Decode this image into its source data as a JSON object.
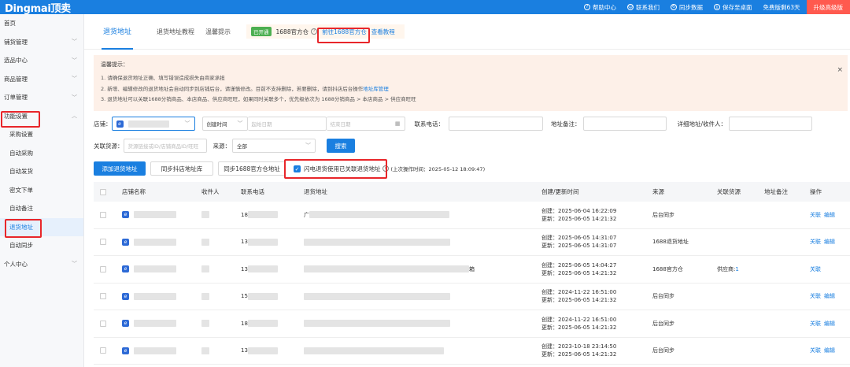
{
  "topbar": {
    "logo": "Dingmai顶卖",
    "links": [
      {
        "icon": "help-circle-icon",
        "glyph": "?",
        "label": "帮助中心"
      },
      {
        "icon": "contact-icon",
        "glyph": "☺",
        "label": "联系我们"
      },
      {
        "icon": "sync-icon",
        "glyph": "↻",
        "label": "同步数据"
      },
      {
        "icon": "desktop-download-icon",
        "glyph": "⤓",
        "label": "保存至桌面"
      }
    ],
    "trial": "免费版剩63天",
    "upgrade": "升级高级版"
  },
  "sidebar": {
    "items": [
      {
        "label": "首页",
        "chev": ""
      },
      {
        "label": "铺货管理",
        "chev": "﹀"
      },
      {
        "label": "选品中心",
        "chev": "﹀"
      },
      {
        "label": "商品管理",
        "chev": "﹀"
      },
      {
        "label": "订单管理",
        "chev": "﹀"
      },
      {
        "label": "功能设置",
        "chev": "︿"
      },
      {
        "label": "采购设置",
        "chev": "",
        "sub": true
      },
      {
        "label": "自动采购",
        "chev": "",
        "sub": true
      },
      {
        "label": "自动发货",
        "chev": "",
        "sub": true
      },
      {
        "label": "密文下单",
        "chev": "",
        "sub": true
      },
      {
        "label": "自动备注",
        "chev": "",
        "sub": true
      },
      {
        "label": "退货地址",
        "chev": "",
        "sub": true,
        "active": true
      },
      {
        "label": "自动同步",
        "chev": "",
        "sub": true
      },
      {
        "label": "个人中心",
        "chev": "﹀"
      }
    ]
  },
  "tabs": {
    "active": "退货地址",
    "others": [
      "退货地址教程",
      "温馨提示"
    ],
    "opened_tag": "已开通",
    "warehouse": "1688官方仓",
    "goto_link": "前往1688官方仓",
    "tutorial_link": "查看教程"
  },
  "notice": {
    "title": "温馨提示：",
    "line1": "1. 请确保退货地址正确、填写错误造成损失由商家承担",
    "line2a": "2. 新增、编辑修改的退货地址会自动同步到店铺后台，请谨慎修改。目前不支持删除，若要删除，请到抖店后台操作",
    "line2b": "地址库管理",
    "line3": "3. 退货地址可以关联1688分销商品、本店商品、供应商旺旺，如果同时关联多个，优先级依次为 1688分销商品 > 本店商品 > 供应商旺旺",
    "close": "×"
  },
  "filters": {
    "shop_label": "店铺：",
    "time_select": "创建时间",
    "start_placeholder": "起始日期",
    "end_placeholder": "结束日期",
    "phone_label": "联系电话：",
    "addr_note_label": "地址备注：",
    "detail_label": "详细地址/收件人：",
    "related_label": "关联货源：",
    "related_placeholder": "货源链接或ID/店铺商品ID/旺旺",
    "source_label": "来源：",
    "source_value": "全部",
    "search_btn": "搜索"
  },
  "actions": {
    "add": "添加退货地址",
    "sync_douyin": "同步抖店地址库",
    "sync_1688": "同步1688官方仓地址",
    "flash_label": "闪电退货使用已关联退货地址",
    "last_op": "(上次操作时间：2025-05-12 18:09:47)"
  },
  "table": {
    "headers": [
      "店铺名称",
      "收件人",
      "联系电话",
      "退货地址",
      "创建/更新时间",
      "来源",
      "关联货源",
      "地址备注",
      "操作"
    ],
    "rows": [
      {
        "phone": "18",
        "addr_prefix": "广",
        "addr_suffix": "",
        "created": "创建：2025-06-04 16:22:09",
        "updated": "更新：2025-06-05 14:21:32",
        "source": "后台同步",
        "related": "",
        "ops": [
          "关联",
          "编辑"
        ]
      },
      {
        "phone": "13",
        "addr_prefix": "",
        "addr_suffix": "",
        "created": "创建：2025-06-05 14:31:07",
        "updated": "更新：2025-06-05 14:31:07",
        "source": "1688退货地址",
        "related": "",
        "ops": [
          "关联",
          "编辑"
        ]
      },
      {
        "phone": "13",
        "addr_prefix": "",
        "addr_suffix": "箱",
        "created": "创建：2025-06-05 14:04:27",
        "updated": "更新：2025-06-05 14:21:32",
        "source": "1688官方仓",
        "related": "供应商:1",
        "ops": [
          "关联"
        ]
      },
      {
        "phone": "15",
        "addr_prefix": "",
        "addr_suffix": "",
        "created": "创建：2024-11-22 16:51:00",
        "updated": "更新：2025-06-05 14:21:32",
        "source": "后台同步",
        "related": "",
        "ops": [
          "关联",
          "编辑"
        ]
      },
      {
        "phone": "18",
        "addr_prefix": "",
        "addr_suffix": "",
        "created": "创建：2024-11-22 16:51:00",
        "updated": "更新：2025-06-05 14:21:32",
        "source": "后台同步",
        "related": "",
        "ops": [
          "关联",
          "编辑"
        ]
      },
      {
        "phone": "13",
        "addr_prefix": "",
        "addr_suffix": "",
        "created": "创建：2023-10-18 23:14:50",
        "updated": "更新：2025-06-05 14:21:32",
        "source": "后台同步",
        "related": "",
        "ops": [
          "关联",
          "编辑"
        ]
      }
    ]
  },
  "colors": {
    "primary": "#1a7fe0",
    "highlight_box": "#e8262a",
    "upgrade": "#ff5a4f"
  }
}
